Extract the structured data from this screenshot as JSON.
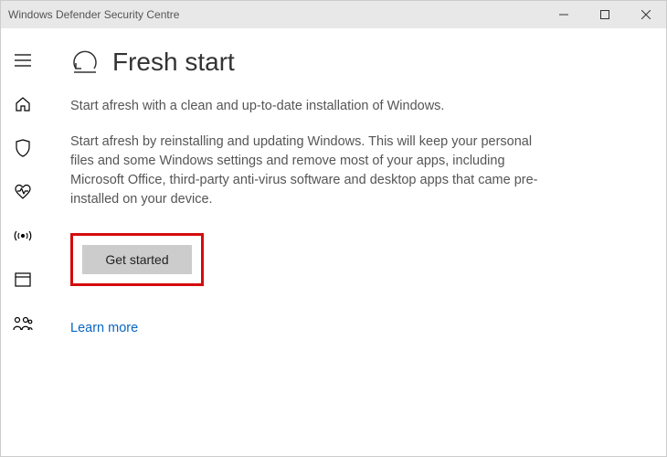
{
  "window": {
    "title": "Windows Defender Security Centre"
  },
  "sidebar": {
    "items": [
      {
        "name": "menu"
      },
      {
        "name": "home"
      },
      {
        "name": "shield"
      },
      {
        "name": "health"
      },
      {
        "name": "network"
      },
      {
        "name": "browser"
      },
      {
        "name": "family"
      }
    ]
  },
  "page": {
    "heading": "Fresh start",
    "lead": "Start afresh with a clean and up-to-date installation of Windows.",
    "description": "Start afresh by reinstalling and updating Windows. This will keep your personal files and some Windows settings and remove most of your apps, including Microsoft Office, third-party anti-virus software and desktop apps that came pre-installed on your device.",
    "get_started_label": "Get started",
    "learn_more_label": "Learn more"
  }
}
